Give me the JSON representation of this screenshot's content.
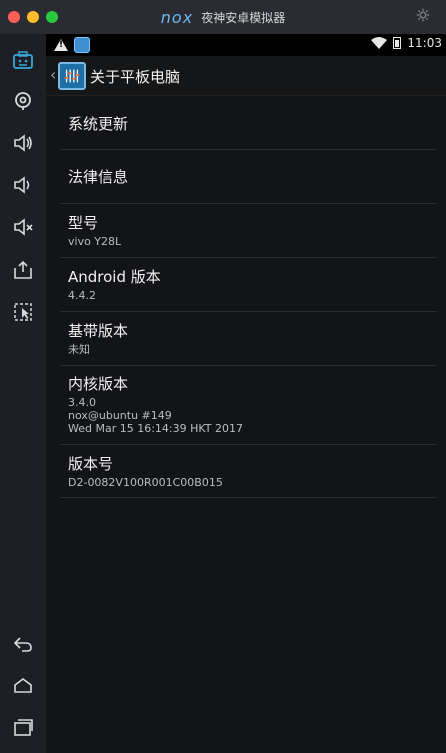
{
  "window": {
    "brand_logo": "nox",
    "title": "夜神安卓模拟器"
  },
  "statusbar": {
    "time": "11:03"
  },
  "actionbar": {
    "title": "关于平板电脑"
  },
  "items": [
    {
      "title": "系统更新",
      "summary": []
    },
    {
      "title": "法律信息",
      "summary": []
    },
    {
      "title": "型号",
      "summary": [
        "vivo Y28L"
      ]
    },
    {
      "title": "Android 版本",
      "summary": [
        "4.4.2"
      ]
    },
    {
      "title": "基带版本",
      "summary": [
        "未知"
      ]
    },
    {
      "title": "内核版本",
      "summary": [
        "3.4.0",
        "nox@ubuntu #149",
        "Wed Mar 15 16:14:39 HKT 2017"
      ]
    },
    {
      "title": "版本号",
      "summary": [
        "D2-0082V100R001C00B015"
      ]
    }
  ],
  "colors": {
    "titlebar_bg": "#2a2c31",
    "sidebar_accent": "#38a7d8",
    "sidebar_icon": "#d7d9dd",
    "screen_bg": "#131417"
  },
  "icons": {
    "sidebar": [
      "keyboard-icon",
      "location-icon",
      "volume-up-icon",
      "volume-down-icon",
      "mute-icon",
      "screenshot-icon",
      "multi-instance-icon"
    ],
    "nav": [
      "back-icon",
      "home-icon",
      "recents-icon"
    ]
  }
}
